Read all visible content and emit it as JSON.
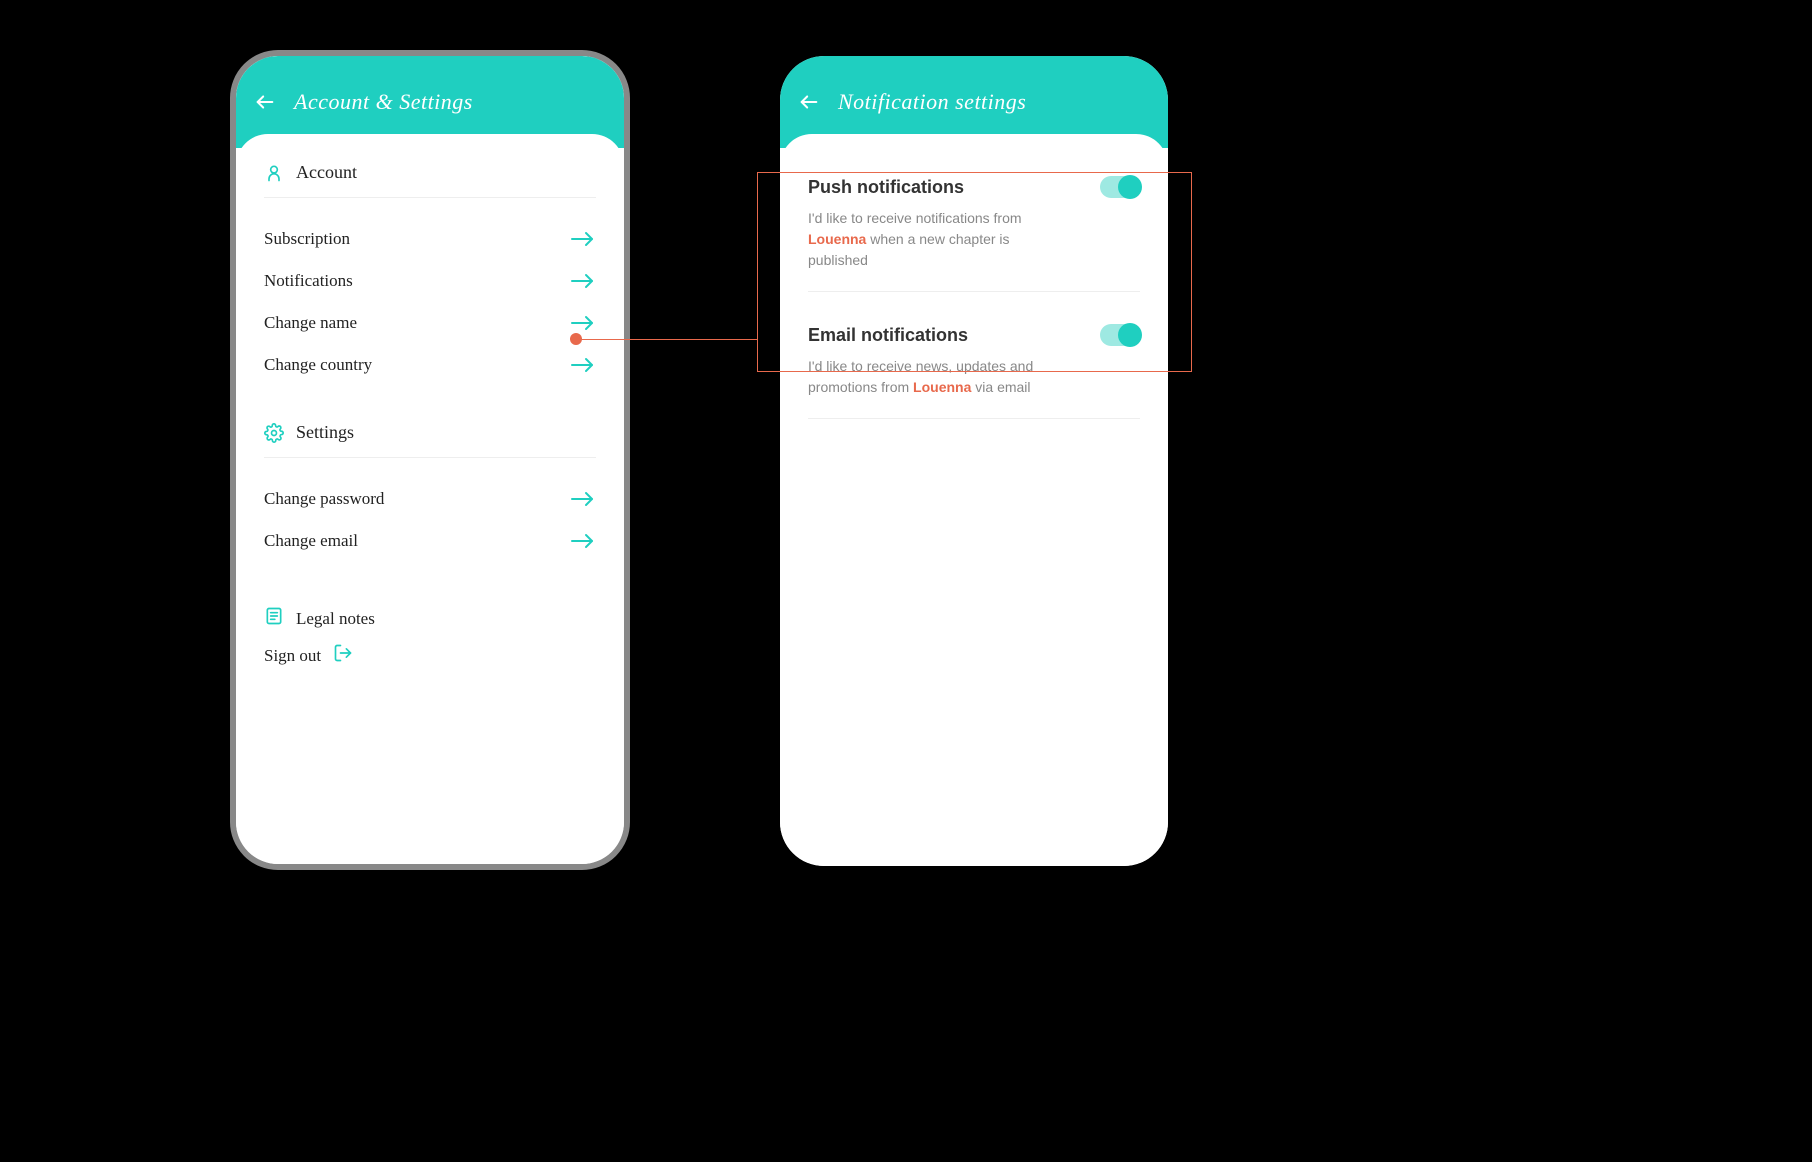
{
  "colors": {
    "accent": "#1fcfc0",
    "brand_highlight": "#e8694c"
  },
  "screen1": {
    "header_title": "Account & Settings",
    "section_account": {
      "title": "Account",
      "items": [
        {
          "label": "Subscription"
        },
        {
          "label": "Notifications"
        },
        {
          "label": "Change name"
        },
        {
          "label": "Change country"
        }
      ]
    },
    "section_settings": {
      "title": "Settings",
      "items": [
        {
          "label": "Change password"
        },
        {
          "label": "Change email"
        }
      ]
    },
    "legal_notes_label": "Legal notes",
    "sign_out_label": "Sign out"
  },
  "screen2": {
    "header_title": "Notification settings",
    "push": {
      "title": "Push notifications",
      "desc_before": "I'd like to receive notifications from ",
      "brand": "Louenna",
      "desc_after": " when a new chapter is published",
      "enabled": true
    },
    "email": {
      "title": "Email notifications",
      "desc_before": "I'd like to receive news, updates and promotions from ",
      "brand": "Louenna",
      "desc_after": " via email",
      "enabled": true
    }
  }
}
